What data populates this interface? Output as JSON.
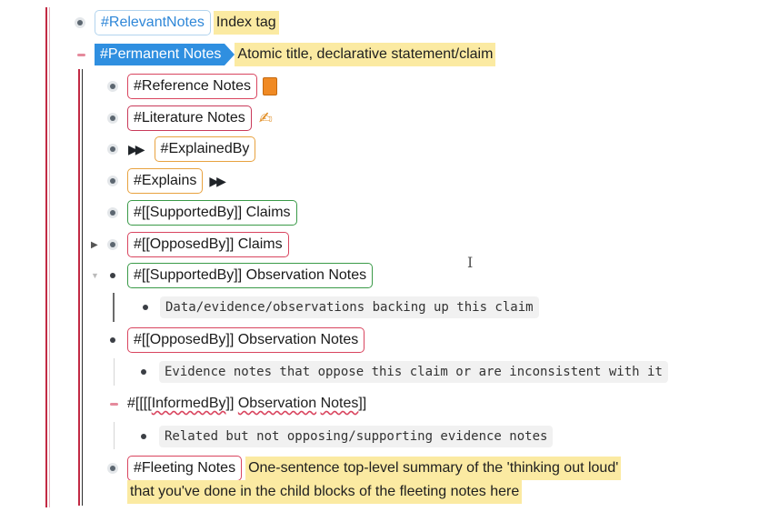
{
  "blocks": {
    "relevant": {
      "tag": "#RelevantNotes",
      "text": "Index tag"
    },
    "permanent": {
      "tag": "#Permanent Notes",
      "text": "Atomic title, declarative statement/claim"
    },
    "reference": {
      "tag": "#Reference Notes",
      "emoji": "📙"
    },
    "literature": {
      "tag": "#Literature Notes",
      "emoji": "✍"
    },
    "explained_by": {
      "prefix": "▶▶",
      "tag": "#ExplainedBy"
    },
    "explains": {
      "tag": "#Explains",
      "suffix": "▶▶"
    },
    "supported_claims": {
      "tag": "#[[SupportedBy]] Claims"
    },
    "opposed_claims": {
      "tag": "#[[OpposedBy]] Claims"
    },
    "supported_obs": {
      "tag": "#[[SupportedBy]] Observation Notes",
      "child": "Data/evidence/observations backing up this claim"
    },
    "opposed_obs": {
      "tag": "#[[OpposedBy]] Observation Notes",
      "child": "Evidence notes that oppose this claim or are inconsistent with it"
    },
    "informed_obs": {
      "text_prefix": "#[[[[",
      "text_informed": "InformedBy",
      "text_mid": "]] ",
      "text_obs": "Observation",
      "text_space": " ",
      "text_notes": "Notes",
      "text_suffix": "]]",
      "child": "Related but not opposing/supporting evidence notes"
    },
    "fleeting": {
      "tag": "#Fleeting Notes",
      "line1": "One-sentence top-level summary of the 'thinking out loud'",
      "line2": "that you've done in the child blocks of the fleeting notes here"
    }
  },
  "cursor": "I"
}
